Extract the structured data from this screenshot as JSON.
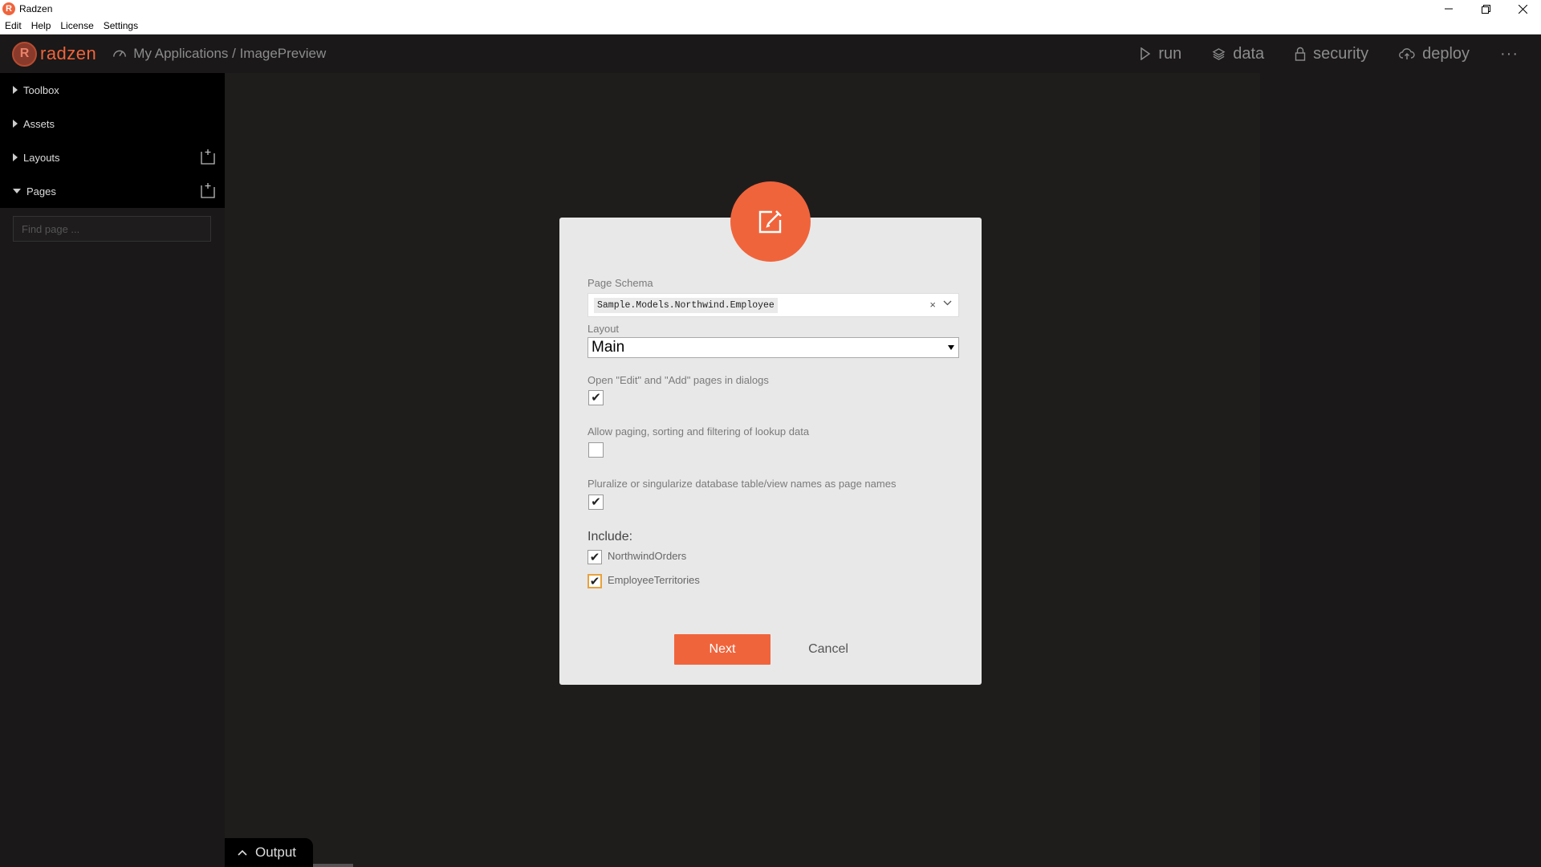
{
  "window": {
    "title": "Radzen",
    "logo_letter": "R"
  },
  "menubar": {
    "items": [
      "Edit",
      "Help",
      "License",
      "Settings"
    ]
  },
  "header": {
    "brand": "radzen",
    "breadcrumb": "My Applications / ImagePreview",
    "nav": [
      {
        "label": "run",
        "icon": "play-icon"
      },
      {
        "label": "data",
        "icon": "layers-icon"
      },
      {
        "label": "security",
        "icon": "lock-icon"
      },
      {
        "label": "deploy",
        "icon": "cloud-upload-icon"
      }
    ],
    "more": "···"
  },
  "sidebar": {
    "sections": [
      {
        "label": "Toolbox",
        "expanded": false
      },
      {
        "label": "Assets",
        "expanded": false
      },
      {
        "label": "Layouts",
        "expanded": false
      },
      {
        "label": "Pages",
        "expanded": true
      }
    ],
    "search_placeholder": "Find page ..."
  },
  "output": {
    "label": "Output"
  },
  "dialog": {
    "icon": "edit-icon",
    "page_schema_label": "Page Schema",
    "page_schema_value": "Sample.Models.Northwind.Employee",
    "clear_glyph": "×",
    "layout_label": "Layout",
    "layout_value": "Main",
    "options": [
      {
        "label": "Open \"Edit\" and \"Add\" pages in dialogs",
        "checked": true
      },
      {
        "label": "Allow paging, sorting and filtering of lookup data",
        "checked": false
      },
      {
        "label": "Pluralize or singularize database table/view names as page names",
        "checked": true
      }
    ],
    "include_title": "Include:",
    "include": [
      {
        "label": "NorthwindOrders",
        "checked": true
      },
      {
        "label": "EmployeeTerritories",
        "checked": true
      }
    ],
    "next_label": "Next",
    "cancel_label": "Cancel"
  },
  "colors": {
    "accent": "#f0643c",
    "background": "#1f1d1c",
    "sidebar": "#1a1818"
  }
}
